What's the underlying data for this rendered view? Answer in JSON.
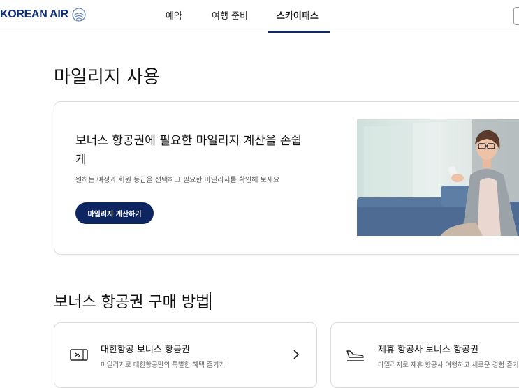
{
  "header": {
    "logo_text": "KOREAN AIR",
    "nav": [
      {
        "label": "예약"
      },
      {
        "label": "여행 준비"
      },
      {
        "label": "스카이패스"
      }
    ]
  },
  "page": {
    "title": "마일리지 사용"
  },
  "calculator": {
    "title": "보너스 항공권에 필요한 마일리지 계산을 손쉽게",
    "subtitle": "원하는 여정과 회원 등급을 선택하고 필요한 마일리지를 확인해 보세요",
    "button_label": "마일리지 계산하기"
  },
  "purchase": {
    "title": "보너스 항공권 구매 방법",
    "cards": [
      {
        "title": "대한항공 보너스 항공권",
        "desc": "마일리지로 대한항공만의 특별한 혜택 즐기기",
        "icon": "ticket-icon"
      },
      {
        "title": "제휴 항공사 보너스 항공권",
        "desc": "마일리지로 제휴 항공사 여행하고 새로운 경험 즐기기",
        "icon": "airplane-landing-icon"
      }
    ]
  },
  "colors": {
    "brand": "#0b2d7d",
    "button": "#0d2560",
    "nav_underline": "#0e2a6b"
  }
}
